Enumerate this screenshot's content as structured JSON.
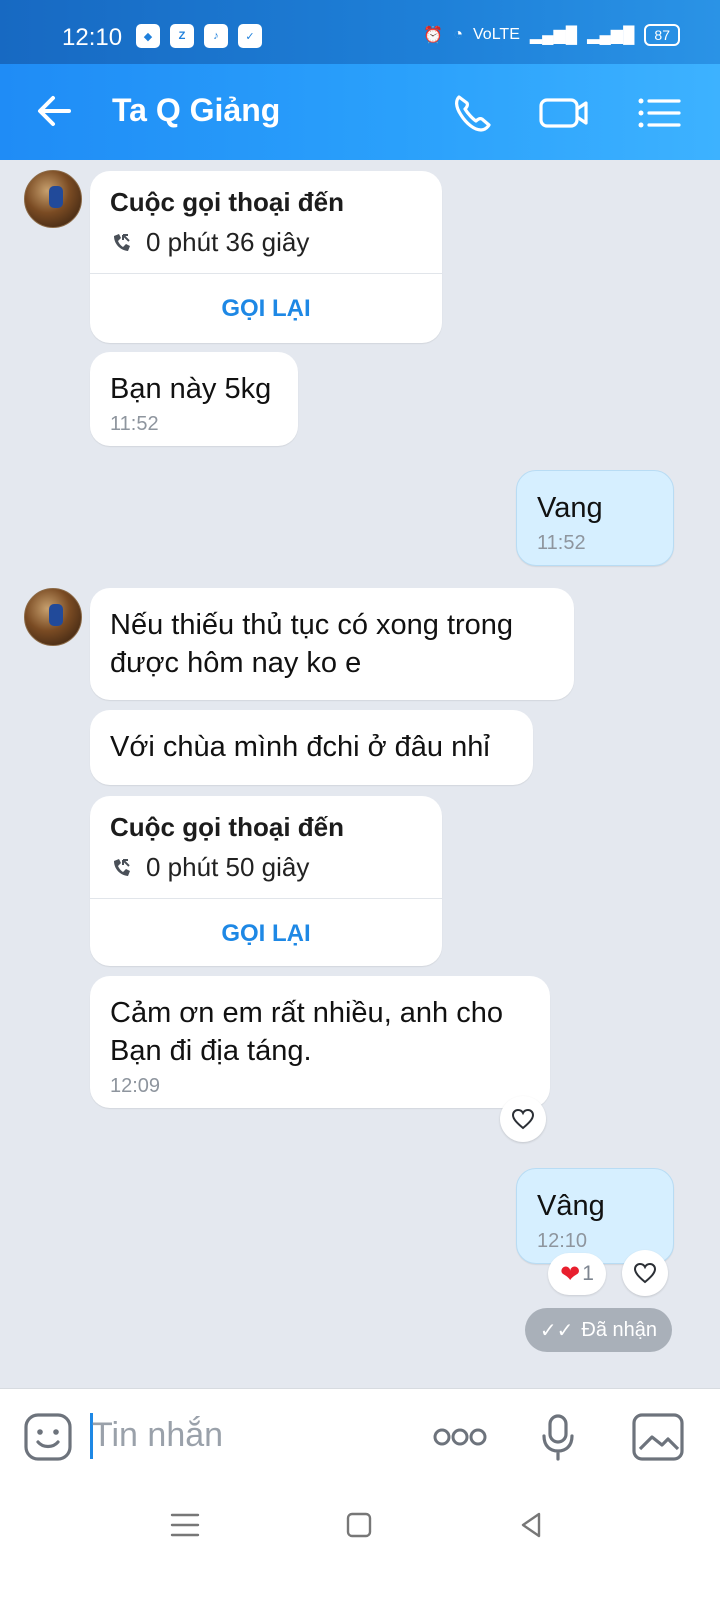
{
  "status_bar": {
    "time": "12:10",
    "battery": "87",
    "network": "VoLTE"
  },
  "header": {
    "title": "Ta Q Giảng"
  },
  "messages": {
    "call1": {
      "title": "Cuộc gọi thoại đến",
      "duration": "0 phút 36 giây",
      "action": "GỌI LẠI"
    },
    "m1": {
      "text": "Bạn này 5kg",
      "time": "11:52"
    },
    "m2": {
      "text": "Vang",
      "time": "11:52"
    },
    "m3": {
      "text": "Nếu thiếu thủ tục có xong trong được hôm nay ko e"
    },
    "m4": {
      "text": "Với chùa mình đchi ở đâu nhỉ"
    },
    "call2": {
      "title": "Cuộc gọi thoại đến",
      "duration": "0 phút 50 giây",
      "action": "GỌI LẠI"
    },
    "m5": {
      "text": "Cảm ơn em rất nhiều, anh cho Bạn đi địa táng.",
      "time": "12:09"
    },
    "m6": {
      "text": "Vâng",
      "time": "12:10",
      "reaction_count": "1",
      "status": "Đã nhận"
    }
  },
  "composer": {
    "placeholder": "Tin nhắn"
  },
  "colors": {
    "header": "#2aa0fb",
    "sent_bubble": "#d6efff",
    "accent": "#1e88e5",
    "background": "#e4e8ef"
  }
}
